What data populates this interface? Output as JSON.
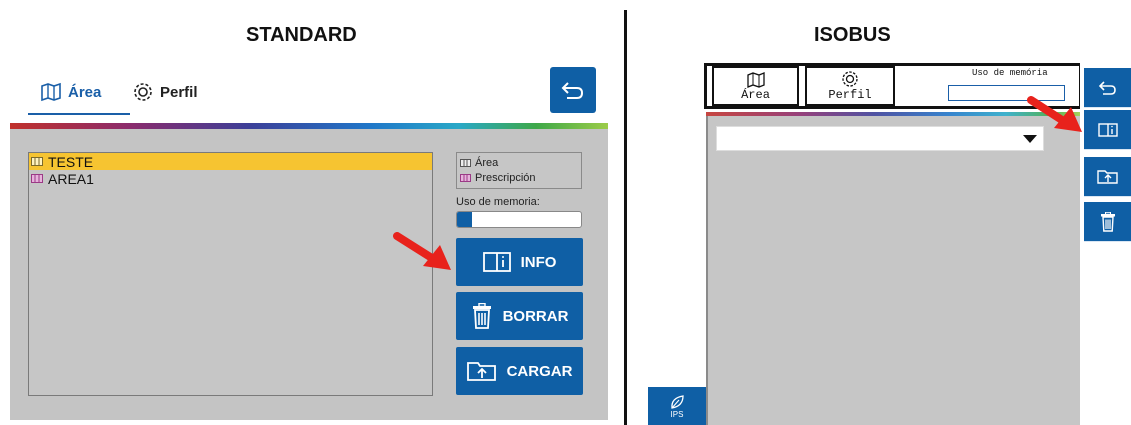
{
  "titles": {
    "standard": "STANDARD",
    "isobus": "ISOBUS"
  },
  "standard": {
    "tabs": [
      {
        "label": "Área",
        "icon": "map-icon",
        "active": true
      },
      {
        "label": "Perfil",
        "icon": "profile-gear-icon",
        "active": false
      }
    ],
    "back_icon": "back-arrow-icon",
    "files": [
      {
        "name": "TESTE",
        "selected": true,
        "icon": "area-file-icon"
      },
      {
        "name": "AREA1",
        "selected": false,
        "icon": "prescription-file-icon"
      }
    ],
    "legend": [
      {
        "label": "Área",
        "icon": "area-file-icon"
      },
      {
        "label": "Prescripción",
        "icon": "prescription-file-icon"
      }
    ],
    "memory_label": "Uso de memoria:",
    "memory_used_fraction": 0.12,
    "buttons": {
      "info": "INFO",
      "borrar": "BORRAR",
      "cargar": "CARGAR"
    }
  },
  "isobus": {
    "tabs": [
      {
        "label": "Área",
        "icon": "map-icon"
      },
      {
        "label": "Perfil",
        "icon": "profile-gear-icon"
      }
    ],
    "memory_label": "Uso de memória",
    "ips_label": "IPS"
  },
  "colors": {
    "primary": "#0f5fa5",
    "selected_row": "#f6c431",
    "panel_gray": "#c4c4c4",
    "arrow_red": "#e8221c"
  }
}
